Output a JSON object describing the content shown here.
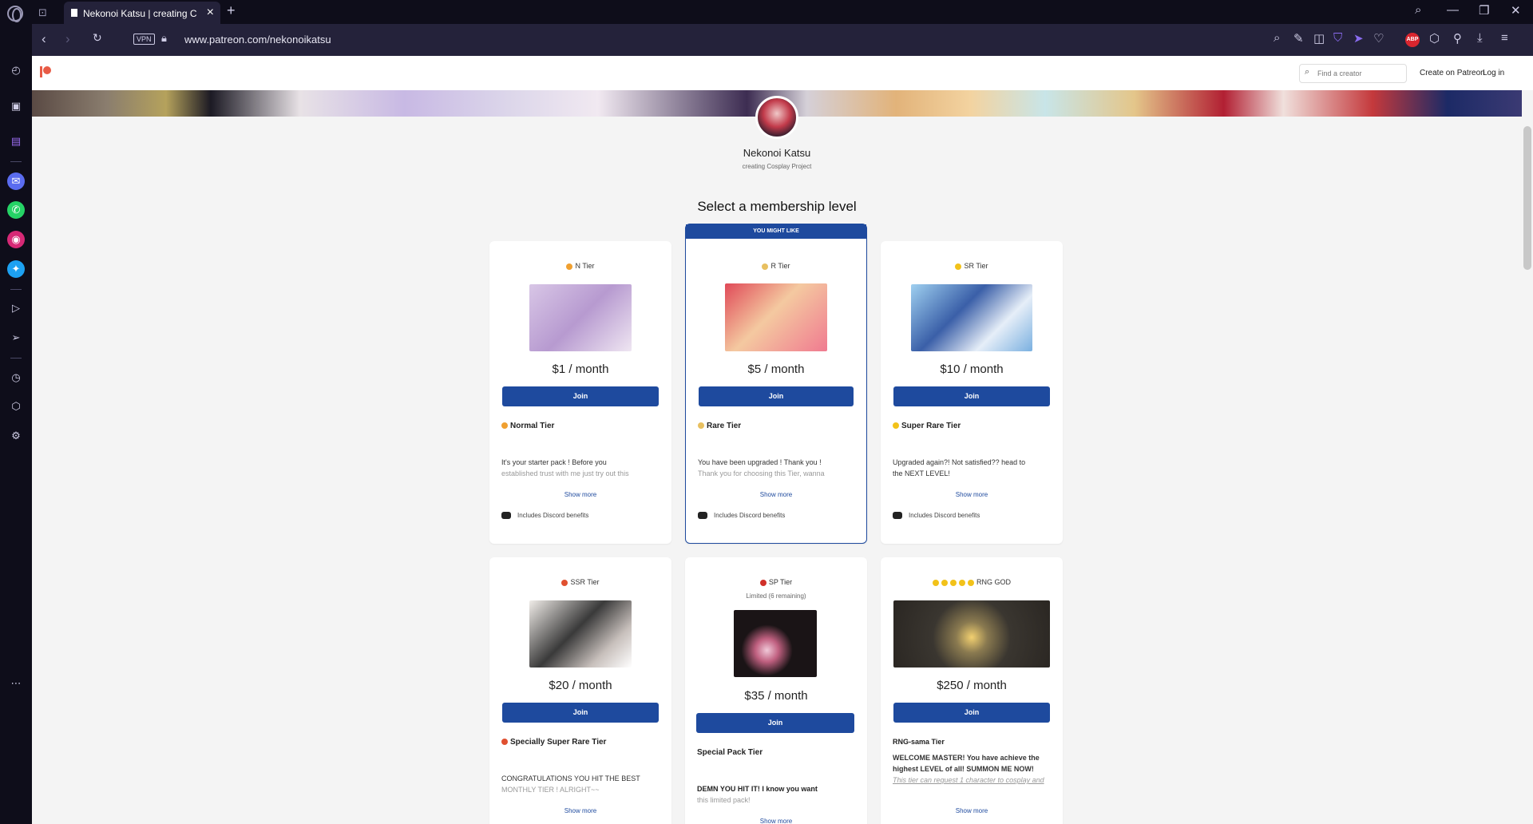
{
  "browser": {
    "tab_title": "Nekonoi Katsu | creating C",
    "url": "www.patreon.com/nekonoikatsu",
    "vpn_label": "VPN",
    "abp_label": "ABP"
  },
  "patreon_nav": {
    "search_placeholder": "Find a creator",
    "create_link": "Create on Patreon",
    "login_link": "Log in"
  },
  "creator": {
    "name": "Nekonoi Katsu",
    "tagline": "creating Cosplay Project"
  },
  "heading": "Select a membership level",
  "featured_ribbon": "YOU MIGHT LIKE",
  "tiers": [
    {
      "name": "N Tier",
      "price": "$1 / month",
      "join": "Join",
      "subtitle": "Normal Tier",
      "desc_line1": "It's your starter pack ! Before you",
      "desc_line2": "established trust with me just try out this",
      "show_more": "Show more",
      "discord": "Includes Discord benefits",
      "emblem_color": "#f0a030"
    },
    {
      "name": "R Tier",
      "price": "$5 / month",
      "join": "Join",
      "subtitle": "Rare Tier",
      "desc_line1": "You have been upgraded ! Thank you !",
      "desc_line2": "Thank you for choosing this Tier, wanna",
      "show_more": "Show more",
      "discord": "Includes Discord benefits",
      "emblem_color": "#e8c060"
    },
    {
      "name": "SR Tier",
      "price": "$10 / month",
      "join": "Join",
      "subtitle": "Super Rare Tier",
      "desc_line1": "Upgraded again?! Not satisfied?? head to",
      "desc_line2": "the NEXT LEVEL!",
      "show_more": "Show more",
      "discord": "Includes Discord benefits",
      "emblem_color": "#f2c21a"
    },
    {
      "name": "SSR Tier",
      "price": "$20 / month",
      "join": "Join",
      "subtitle": "Specially Super Rare Tier",
      "desc_line1": "CONGRATULATIONS YOU HIT THE BEST",
      "desc_line2": "MONTHLY TIER ! ALRIGHT~~",
      "show_more": "Show more",
      "emblem_color": "#e05030"
    },
    {
      "name": "SP Tier",
      "limited": "Limited (6 remaining)",
      "price": "$35 / month",
      "join": "Join",
      "subtitle": "Special Pack Tier",
      "desc_line1": "DEMN YOU HIT IT! I know you want",
      "desc_line2": "this limited pack!",
      "show_more": "Show more",
      "emblem_color": "#d0302a"
    },
    {
      "name": "RNG GOD",
      "price": "$250 / month",
      "join": "Join",
      "subtitle": "RNG-sama Tier",
      "desc_line1": "WELCOME MASTER! You have achieve the",
      "desc_line2": "highest LEVEL of all! SUMMON ME NOW!",
      "desc_line3": "This tier can request 1 character to cosplay and",
      "show_more": "Show more",
      "emblem_color": "#f2c21a"
    }
  ],
  "colors": {
    "brand": "#e85b46",
    "primary": "#1e4a9e",
    "browser_bg": "#0e0d1a"
  }
}
